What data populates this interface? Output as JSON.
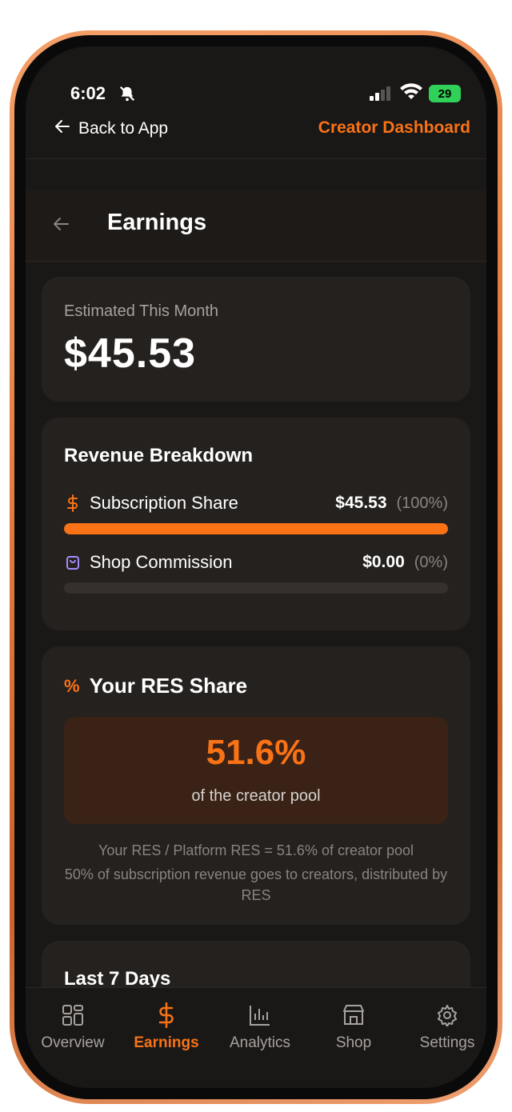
{
  "status": {
    "time": "6:02",
    "battery": "29"
  },
  "topnav": {
    "back_label": "Back to App",
    "dashboard_label": "Creator Dashboard"
  },
  "header": {
    "title": "Earnings"
  },
  "estimate": {
    "label": "Estimated This Month",
    "value": "$45.53"
  },
  "breakdown": {
    "title": "Revenue Breakdown",
    "rows": [
      {
        "label": "Subscription Share",
        "value": "$45.53",
        "percent": "(100%)",
        "fill": 1.0,
        "icon": "dollar-icon"
      },
      {
        "label": "Shop Commission",
        "value": "$0.00",
        "percent": "(0%)",
        "fill": 0.0,
        "icon": "shopping-bag-icon"
      }
    ]
  },
  "res": {
    "title": "Your RES Share",
    "value": "51.6%",
    "subtitle": "of the creator pool",
    "note1": "Your RES / Platform RES = 51.6% of creator pool",
    "note2": "50% of subscription revenue goes to creators, distributed by RES"
  },
  "last7": {
    "title": "Last 7 Days"
  },
  "tabs": [
    {
      "label": "Overview",
      "icon": "grid-icon",
      "active": false
    },
    {
      "label": "Earnings",
      "icon": "dollar-icon",
      "active": true
    },
    {
      "label": "Analytics",
      "icon": "bar-chart-icon",
      "active": false
    },
    {
      "label": "Shop",
      "icon": "store-icon",
      "active": false
    },
    {
      "label": "Settings",
      "icon": "gear-icon",
      "active": false
    }
  ],
  "colors": {
    "accent": "#f97316",
    "background": "#1a1817",
    "card": "#25211f"
  }
}
